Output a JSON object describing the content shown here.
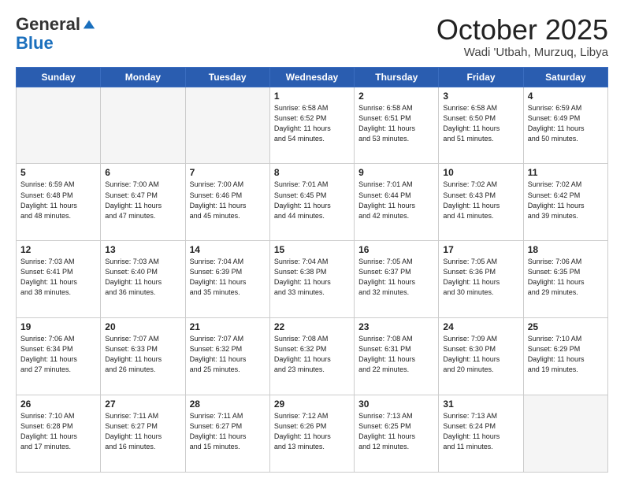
{
  "logo": {
    "general": "General",
    "blue": "Blue"
  },
  "header": {
    "month": "October 2025",
    "location": "Wadi 'Utbah, Murzuq, Libya"
  },
  "days_of_week": [
    "Sunday",
    "Monday",
    "Tuesday",
    "Wednesday",
    "Thursday",
    "Friday",
    "Saturday"
  ],
  "weeks": [
    [
      {
        "day": "",
        "info": ""
      },
      {
        "day": "",
        "info": ""
      },
      {
        "day": "",
        "info": ""
      },
      {
        "day": "1",
        "info": "Sunrise: 6:58 AM\nSunset: 6:52 PM\nDaylight: 11 hours\nand 54 minutes."
      },
      {
        "day": "2",
        "info": "Sunrise: 6:58 AM\nSunset: 6:51 PM\nDaylight: 11 hours\nand 53 minutes."
      },
      {
        "day": "3",
        "info": "Sunrise: 6:58 AM\nSunset: 6:50 PM\nDaylight: 11 hours\nand 51 minutes."
      },
      {
        "day": "4",
        "info": "Sunrise: 6:59 AM\nSunset: 6:49 PM\nDaylight: 11 hours\nand 50 minutes."
      }
    ],
    [
      {
        "day": "5",
        "info": "Sunrise: 6:59 AM\nSunset: 6:48 PM\nDaylight: 11 hours\nand 48 minutes."
      },
      {
        "day": "6",
        "info": "Sunrise: 7:00 AM\nSunset: 6:47 PM\nDaylight: 11 hours\nand 47 minutes."
      },
      {
        "day": "7",
        "info": "Sunrise: 7:00 AM\nSunset: 6:46 PM\nDaylight: 11 hours\nand 45 minutes."
      },
      {
        "day": "8",
        "info": "Sunrise: 7:01 AM\nSunset: 6:45 PM\nDaylight: 11 hours\nand 44 minutes."
      },
      {
        "day": "9",
        "info": "Sunrise: 7:01 AM\nSunset: 6:44 PM\nDaylight: 11 hours\nand 42 minutes."
      },
      {
        "day": "10",
        "info": "Sunrise: 7:02 AM\nSunset: 6:43 PM\nDaylight: 11 hours\nand 41 minutes."
      },
      {
        "day": "11",
        "info": "Sunrise: 7:02 AM\nSunset: 6:42 PM\nDaylight: 11 hours\nand 39 minutes."
      }
    ],
    [
      {
        "day": "12",
        "info": "Sunrise: 7:03 AM\nSunset: 6:41 PM\nDaylight: 11 hours\nand 38 minutes."
      },
      {
        "day": "13",
        "info": "Sunrise: 7:03 AM\nSunset: 6:40 PM\nDaylight: 11 hours\nand 36 minutes."
      },
      {
        "day": "14",
        "info": "Sunrise: 7:04 AM\nSunset: 6:39 PM\nDaylight: 11 hours\nand 35 minutes."
      },
      {
        "day": "15",
        "info": "Sunrise: 7:04 AM\nSunset: 6:38 PM\nDaylight: 11 hours\nand 33 minutes."
      },
      {
        "day": "16",
        "info": "Sunrise: 7:05 AM\nSunset: 6:37 PM\nDaylight: 11 hours\nand 32 minutes."
      },
      {
        "day": "17",
        "info": "Sunrise: 7:05 AM\nSunset: 6:36 PM\nDaylight: 11 hours\nand 30 minutes."
      },
      {
        "day": "18",
        "info": "Sunrise: 7:06 AM\nSunset: 6:35 PM\nDaylight: 11 hours\nand 29 minutes."
      }
    ],
    [
      {
        "day": "19",
        "info": "Sunrise: 7:06 AM\nSunset: 6:34 PM\nDaylight: 11 hours\nand 27 minutes."
      },
      {
        "day": "20",
        "info": "Sunrise: 7:07 AM\nSunset: 6:33 PM\nDaylight: 11 hours\nand 26 minutes."
      },
      {
        "day": "21",
        "info": "Sunrise: 7:07 AM\nSunset: 6:32 PM\nDaylight: 11 hours\nand 25 minutes."
      },
      {
        "day": "22",
        "info": "Sunrise: 7:08 AM\nSunset: 6:32 PM\nDaylight: 11 hours\nand 23 minutes."
      },
      {
        "day": "23",
        "info": "Sunrise: 7:08 AM\nSunset: 6:31 PM\nDaylight: 11 hours\nand 22 minutes."
      },
      {
        "day": "24",
        "info": "Sunrise: 7:09 AM\nSunset: 6:30 PM\nDaylight: 11 hours\nand 20 minutes."
      },
      {
        "day": "25",
        "info": "Sunrise: 7:10 AM\nSunset: 6:29 PM\nDaylight: 11 hours\nand 19 minutes."
      }
    ],
    [
      {
        "day": "26",
        "info": "Sunrise: 7:10 AM\nSunset: 6:28 PM\nDaylight: 11 hours\nand 17 minutes."
      },
      {
        "day": "27",
        "info": "Sunrise: 7:11 AM\nSunset: 6:27 PM\nDaylight: 11 hours\nand 16 minutes."
      },
      {
        "day": "28",
        "info": "Sunrise: 7:11 AM\nSunset: 6:27 PM\nDaylight: 11 hours\nand 15 minutes."
      },
      {
        "day": "29",
        "info": "Sunrise: 7:12 AM\nSunset: 6:26 PM\nDaylight: 11 hours\nand 13 minutes."
      },
      {
        "day": "30",
        "info": "Sunrise: 7:13 AM\nSunset: 6:25 PM\nDaylight: 11 hours\nand 12 minutes."
      },
      {
        "day": "31",
        "info": "Sunrise: 7:13 AM\nSunset: 6:24 PM\nDaylight: 11 hours\nand 11 minutes."
      },
      {
        "day": "",
        "info": ""
      }
    ]
  ]
}
